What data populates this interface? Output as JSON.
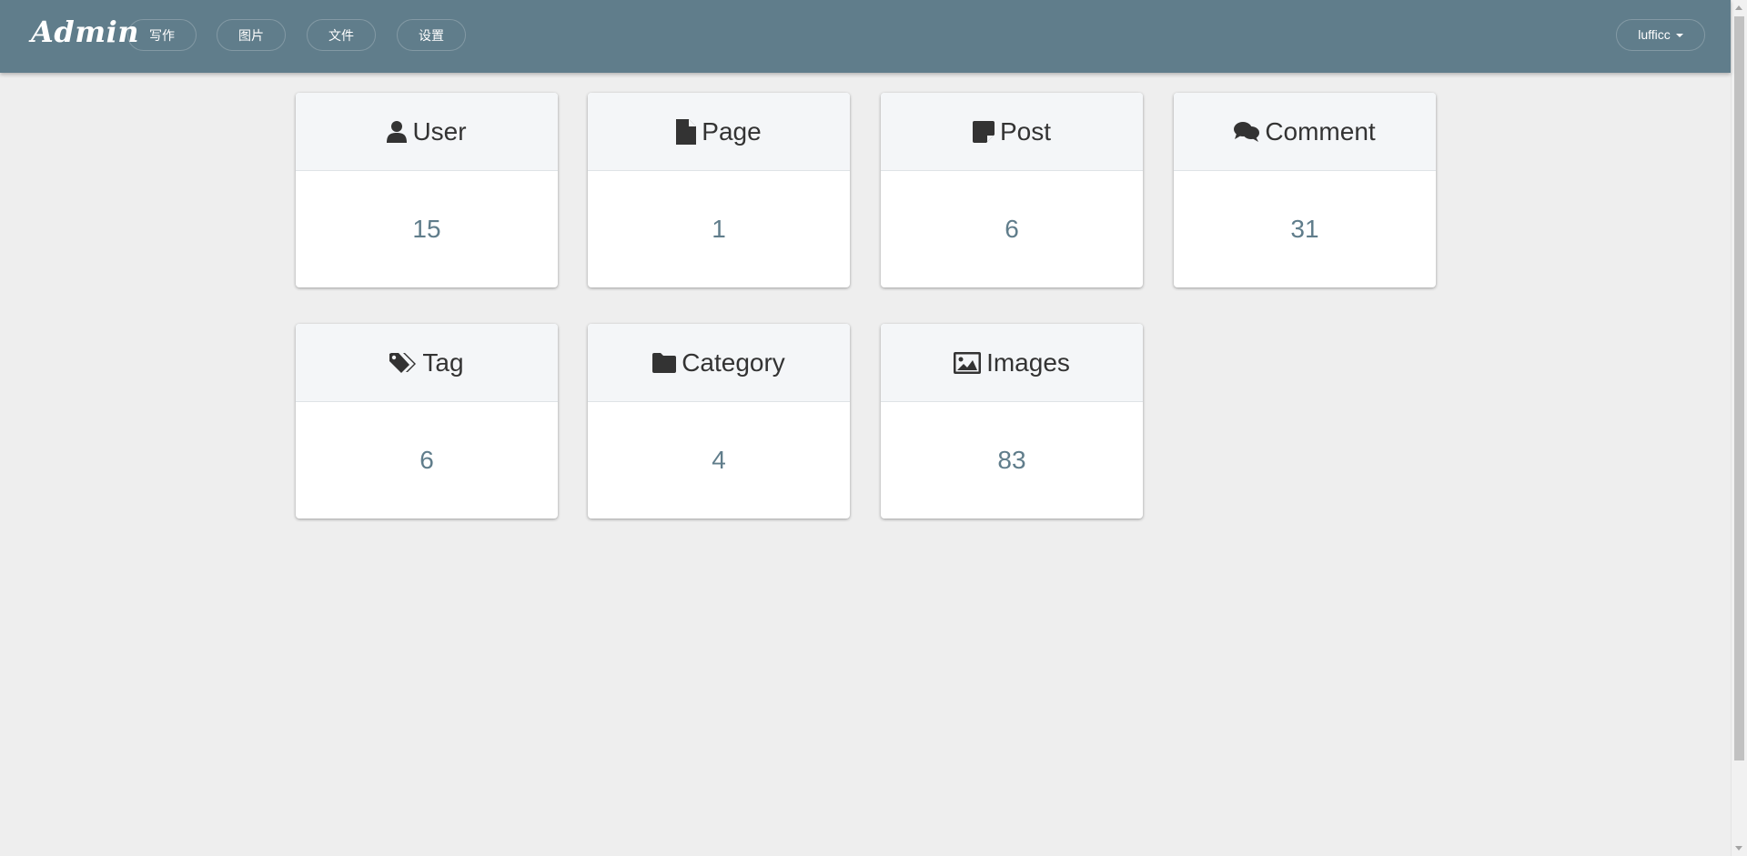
{
  "navbar": {
    "brand": "Admin",
    "items": [
      {
        "label": "写作"
      },
      {
        "label": "图片"
      },
      {
        "label": "文件"
      },
      {
        "label": "设置"
      }
    ],
    "user": "lufficc"
  },
  "cards": [
    {
      "title": "User",
      "count": "15",
      "icon": "user-icon"
    },
    {
      "title": "Page",
      "count": "1",
      "icon": "file-icon"
    },
    {
      "title": "Post",
      "count": "6",
      "icon": "sticky-note-icon"
    },
    {
      "title": "Comment",
      "count": "31",
      "icon": "comments-icon"
    },
    {
      "title": "Tag",
      "count": "6",
      "icon": "tags-icon"
    },
    {
      "title": "Category",
      "count": "4",
      "icon": "folder-icon"
    },
    {
      "title": "Images",
      "count": "83",
      "icon": "image-icon"
    }
  ],
  "colors": {
    "navbar": "#607d8b",
    "accent": "#607d8b",
    "background": "#eeeeee"
  }
}
